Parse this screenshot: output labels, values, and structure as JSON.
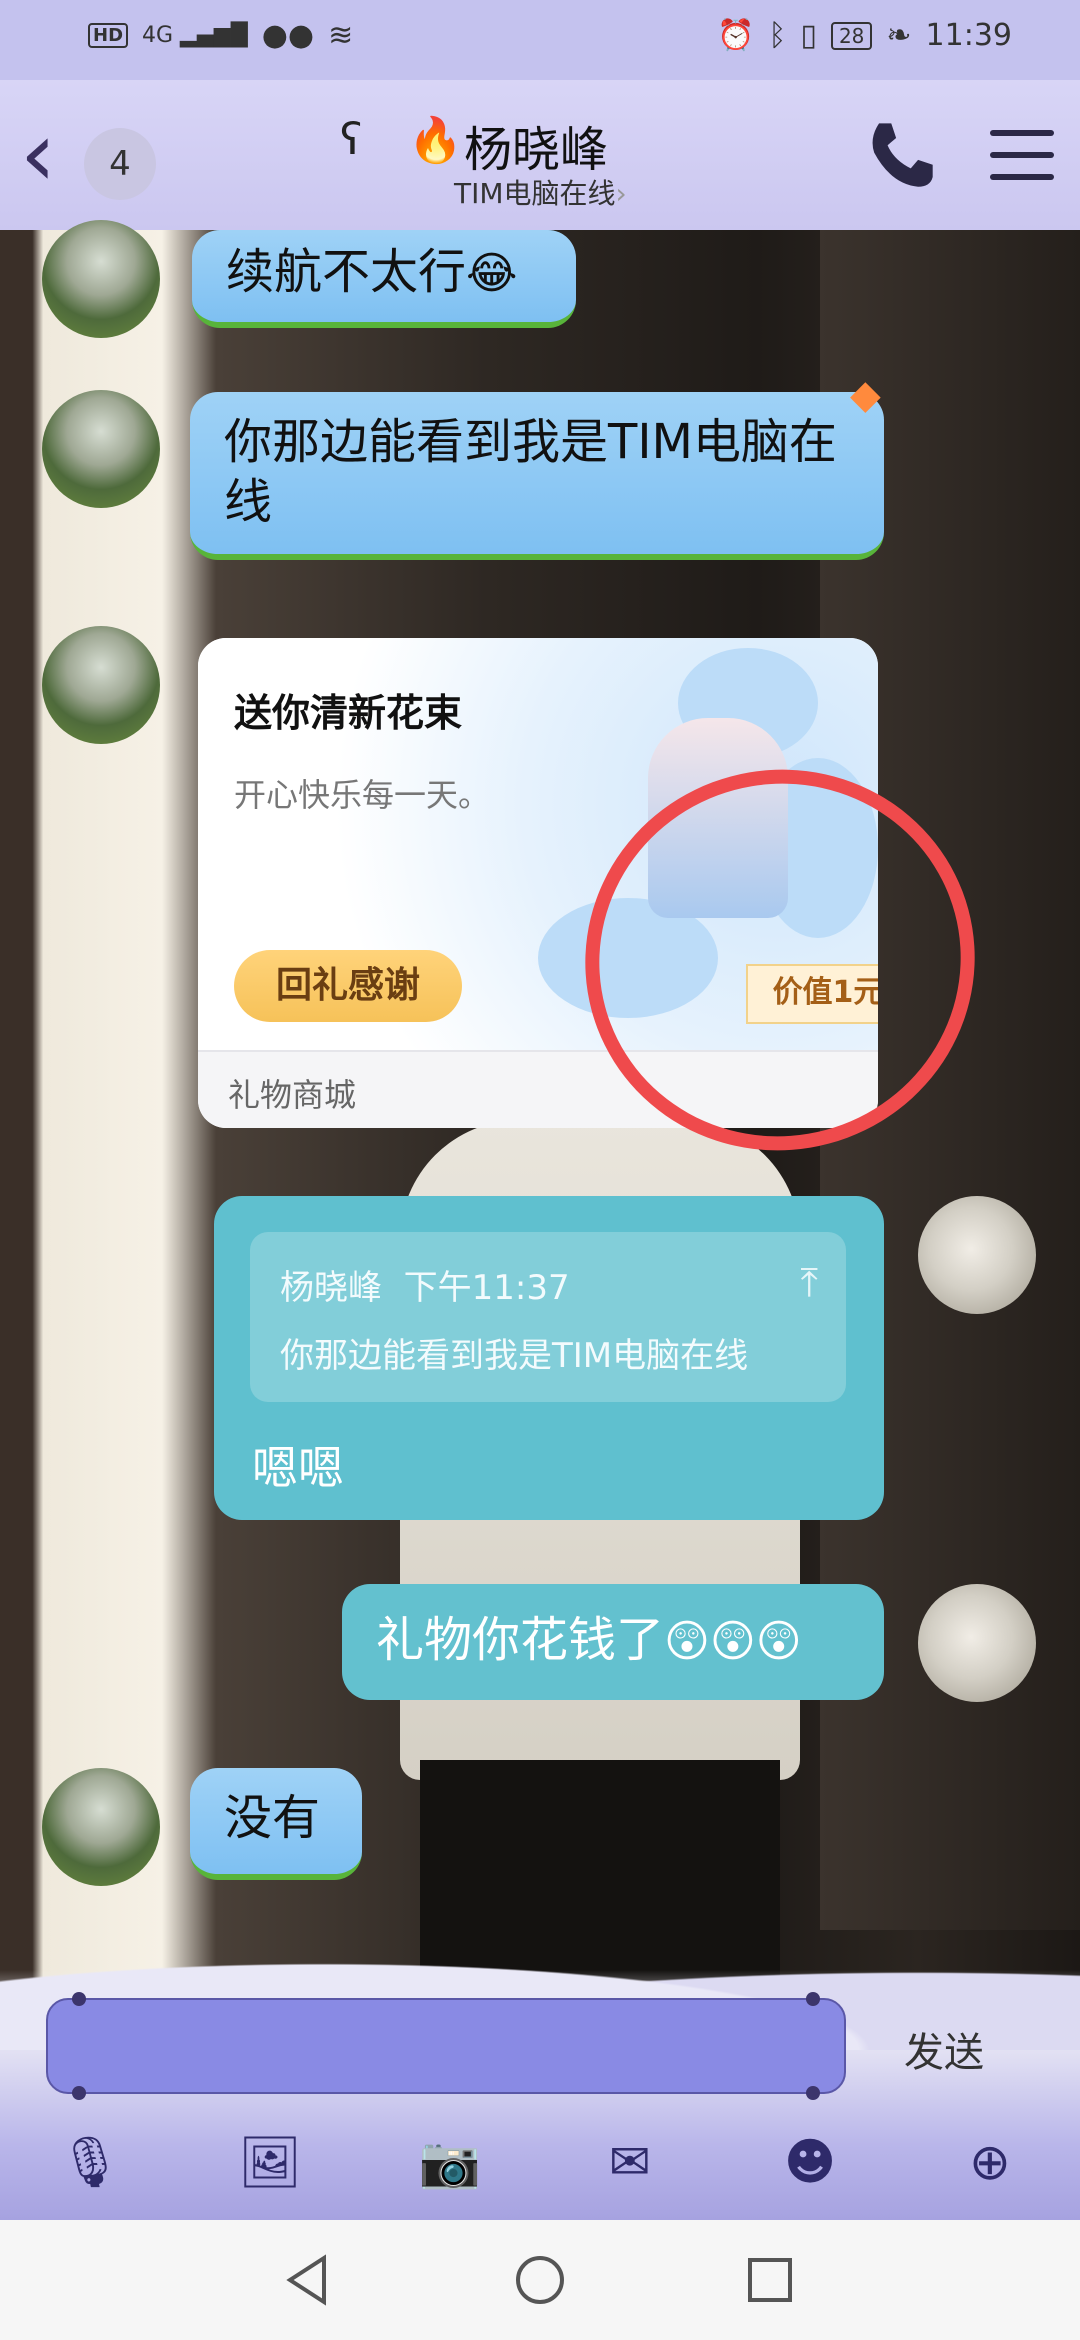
{
  "status_bar": {
    "left_icons": [
      "hd-icon",
      "4g-signal-icon",
      "wechat-icon",
      "wifi-icon"
    ],
    "hd_label": "HD",
    "network_label": "4G",
    "battery": "28",
    "time": "11:39"
  },
  "header": {
    "unread_count": "4",
    "contact_name": "杨晓峰",
    "contact_status": "TIM电脑在线",
    "status_chevron": "›"
  },
  "messages": [
    {
      "side": "left",
      "text": "续航不太行",
      "emoji": "😂"
    },
    {
      "side": "left",
      "text": "你那边能看到我是TIM电脑在线"
    },
    {
      "side": "left",
      "type": "gift",
      "title": "送你清新花束",
      "desc": "开心快乐每一天。",
      "button": "回礼感谢",
      "price_tag": "价值1元",
      "footer": "礼物商城"
    },
    {
      "side": "right",
      "type": "quote",
      "quote_author": "杨晓峰",
      "quote_time": "下午11:37",
      "quote_text": "你那边能看到我是TIM电脑在线",
      "reply": "嗯嗯"
    },
    {
      "side": "right",
      "text": "礼物你花钱了",
      "emoji": "😲😲😲"
    },
    {
      "side": "left",
      "text": "没有"
    }
  ],
  "composer": {
    "send_label": "发送",
    "toolbar_icons": [
      "microphone-icon",
      "image-icon",
      "camera-icon",
      "red-packet-icon",
      "emoji-icon",
      "plus-icon"
    ]
  },
  "colors": {
    "header_bg": "#cbc7f0",
    "incoming_bubble": "#8ec9f4",
    "outgoing_bubble": "#63c1cf",
    "annotation_red": "#ef4a4c",
    "input_bg": "#898ae4"
  }
}
